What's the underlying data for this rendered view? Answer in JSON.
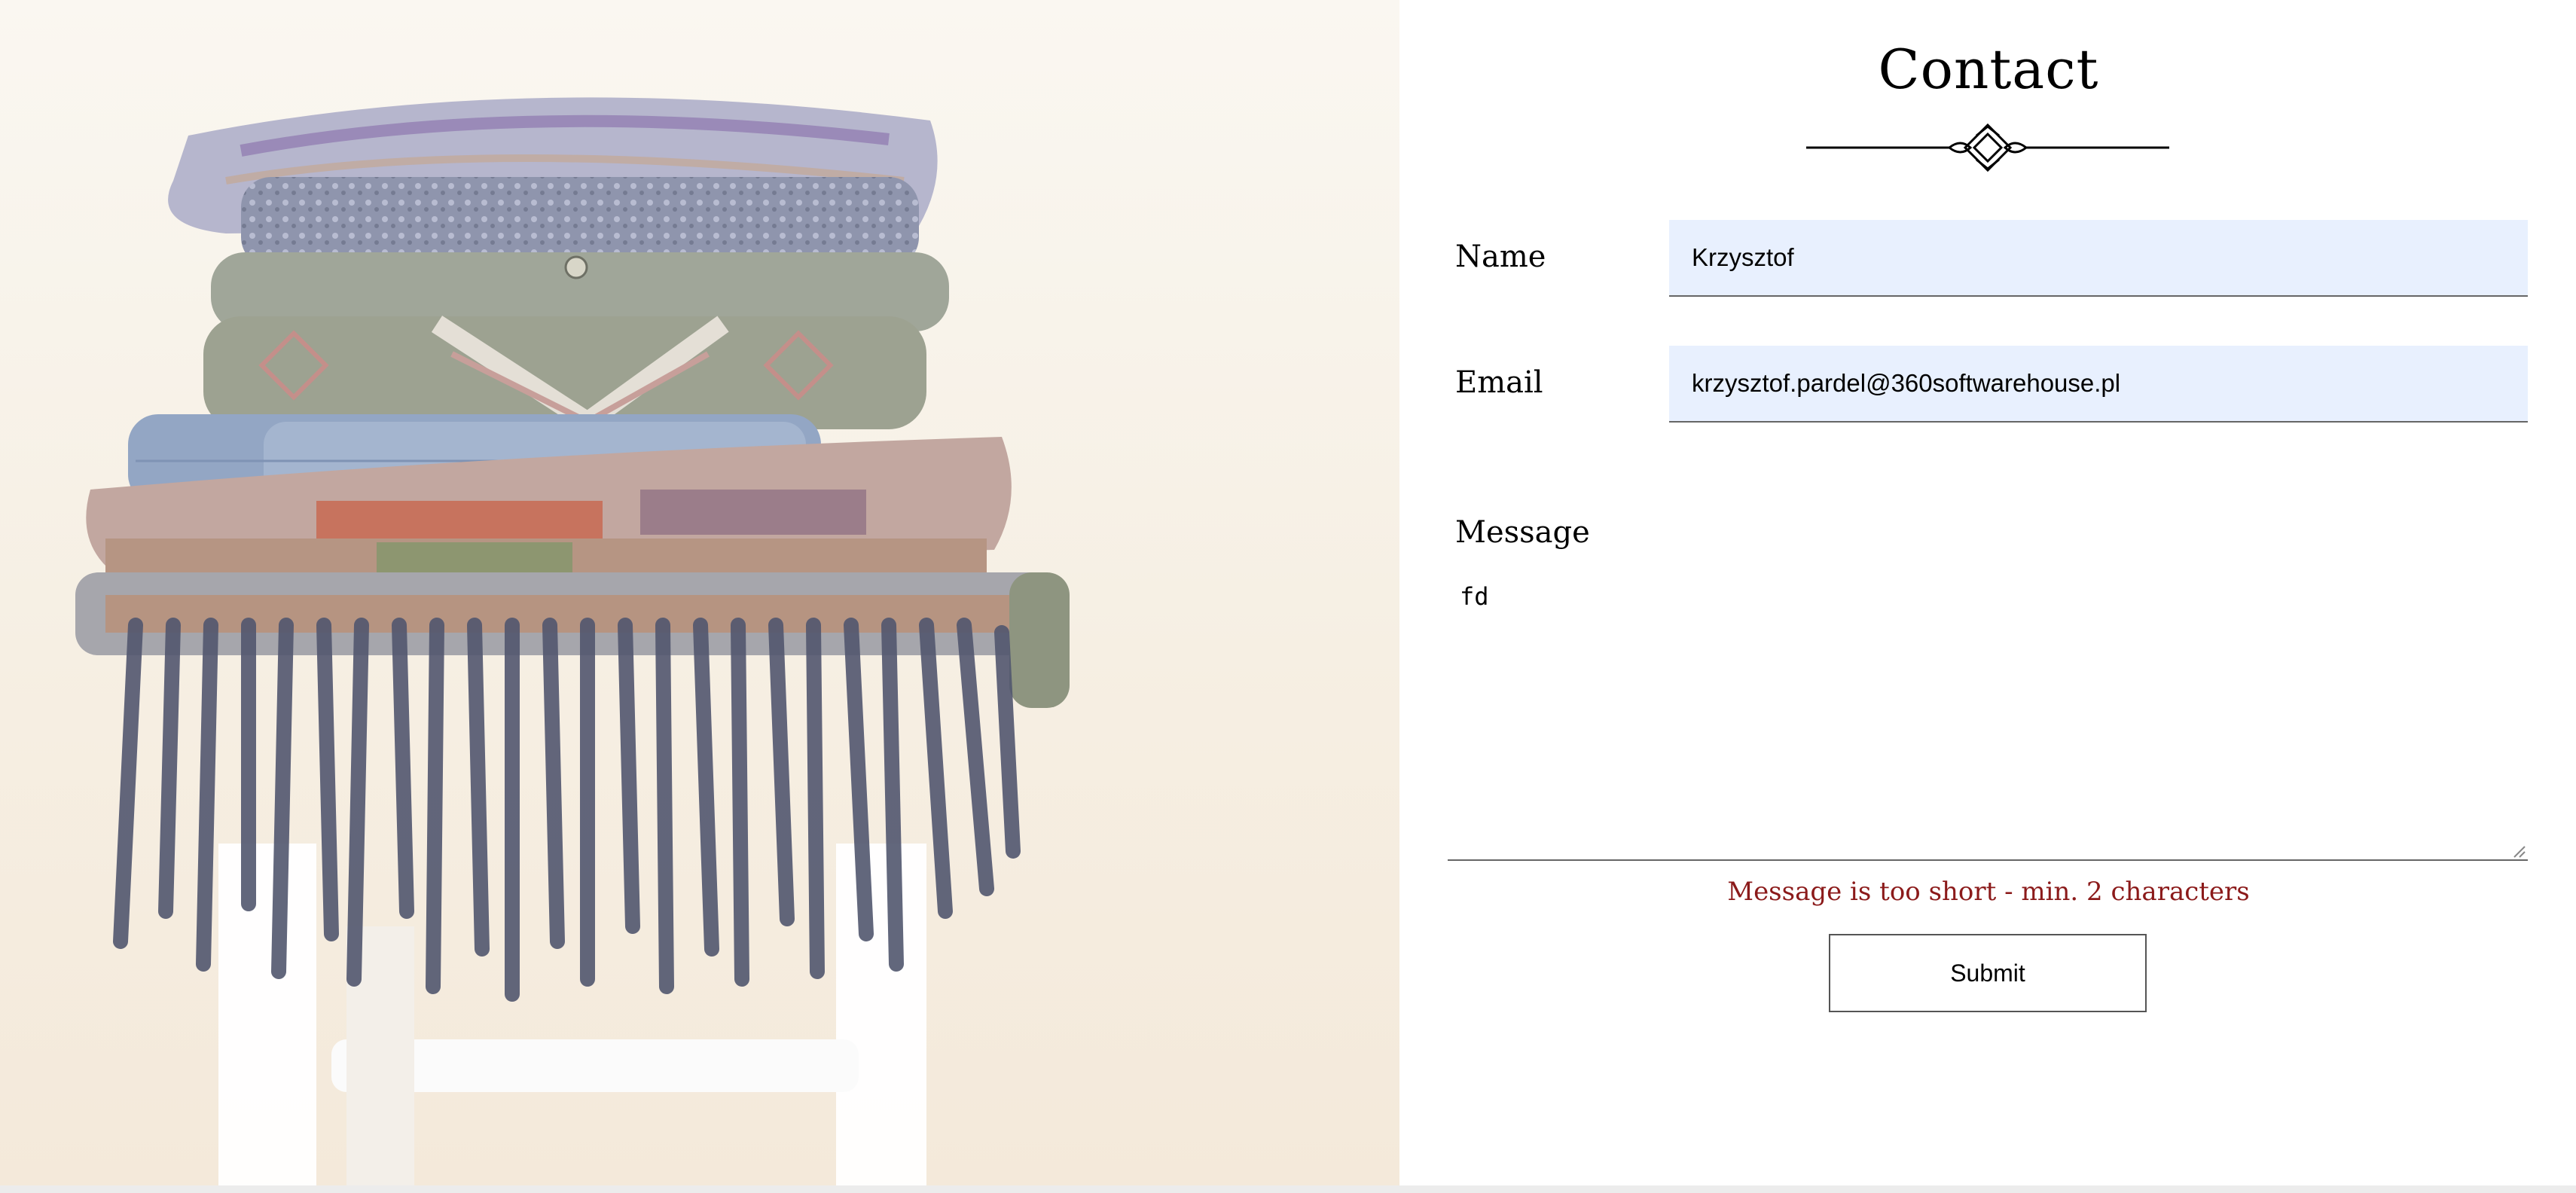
{
  "page": {
    "title": "Contact",
    "image_alt": "Stack of folded knitted blankets on a white stool"
  },
  "form": {
    "name_label": "Name",
    "name_value": "Krzysztof",
    "email_label": "Email",
    "email_value": "krzysztof.pardel@360softwarehouse.pl",
    "message_label": "Message",
    "message_value": "fd",
    "error_text": "Message is too short - min. 2 characters",
    "submit_label": "Submit"
  },
  "colors": {
    "field_background": "#e8f0fe",
    "error": "#8b1a1a",
    "hero_background": "#f6efe3"
  },
  "icons": [
    "ornamental-divider-icon",
    "resize-grip-icon"
  ]
}
